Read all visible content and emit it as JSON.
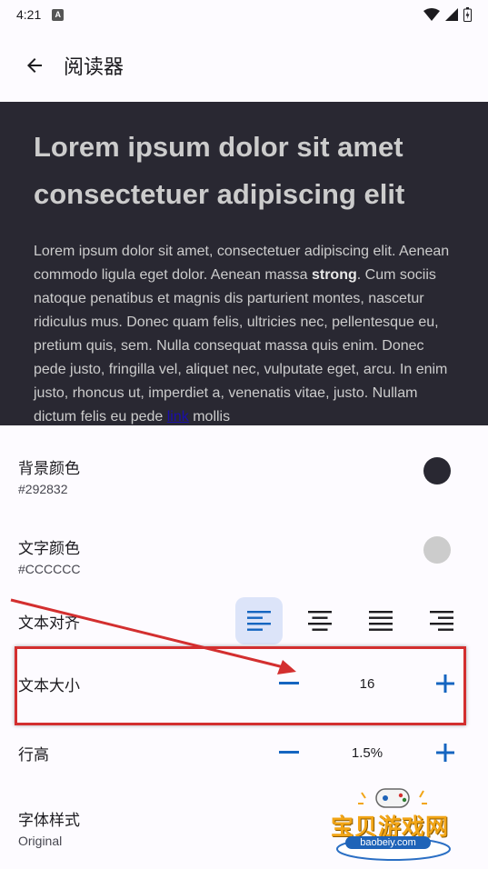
{
  "status_bar": {
    "time": "4:21",
    "notification_letter": "A"
  },
  "app_bar": {
    "title": "阅读器"
  },
  "preview": {
    "heading": "Lorem ipsum dolor sit amet consectetuer adipiscing elit",
    "body_before_strong": "Lorem ipsum dolor sit amet, consectetuer adipiscing elit. Aenean commodo ligula eget dolor. Aenean massa ",
    "strong_text": "strong",
    "body_middle": ". Cum sociis natoque penatibus et magnis dis parturient montes, nascetur ridiculus mus. Donec quam felis, ultricies nec, pellentesque eu, pretium quis, sem. Nulla consequat massa quis enim. Donec pede justo, fringilla vel, aliquet nec, vulputate eget, arcu. In enim justo, rhoncus ut, imperdiet a, venenatis vitae, justo. Nullam dictum felis eu pede ",
    "link_text": "link",
    "body_after_link": " mollis",
    "background_color": "#292832",
    "text_color": "#CCCCCC"
  },
  "settings": {
    "background_color": {
      "label": "背景颜色",
      "value": "#292832",
      "swatch": "#292832"
    },
    "text_color": {
      "label": "文字颜色",
      "value": "#CCCCCC",
      "swatch": "#CCCCCC"
    },
    "text_align": {
      "label": "文本对齐",
      "options": [
        "left",
        "center",
        "justify",
        "right"
      ],
      "selected": "left"
    },
    "text_size": {
      "label": "文本大小",
      "value": "16"
    },
    "line_height": {
      "label": "行高",
      "value": "1.5%"
    },
    "font_style": {
      "label": "字体样式",
      "value": "Original"
    }
  },
  "watermark": {
    "text": "宝贝游戏网",
    "url": "baobeiy.com"
  },
  "colors": {
    "accent": "#1565c0",
    "annotation": "#d32f2f",
    "selected_bg": "#dce4f9"
  }
}
